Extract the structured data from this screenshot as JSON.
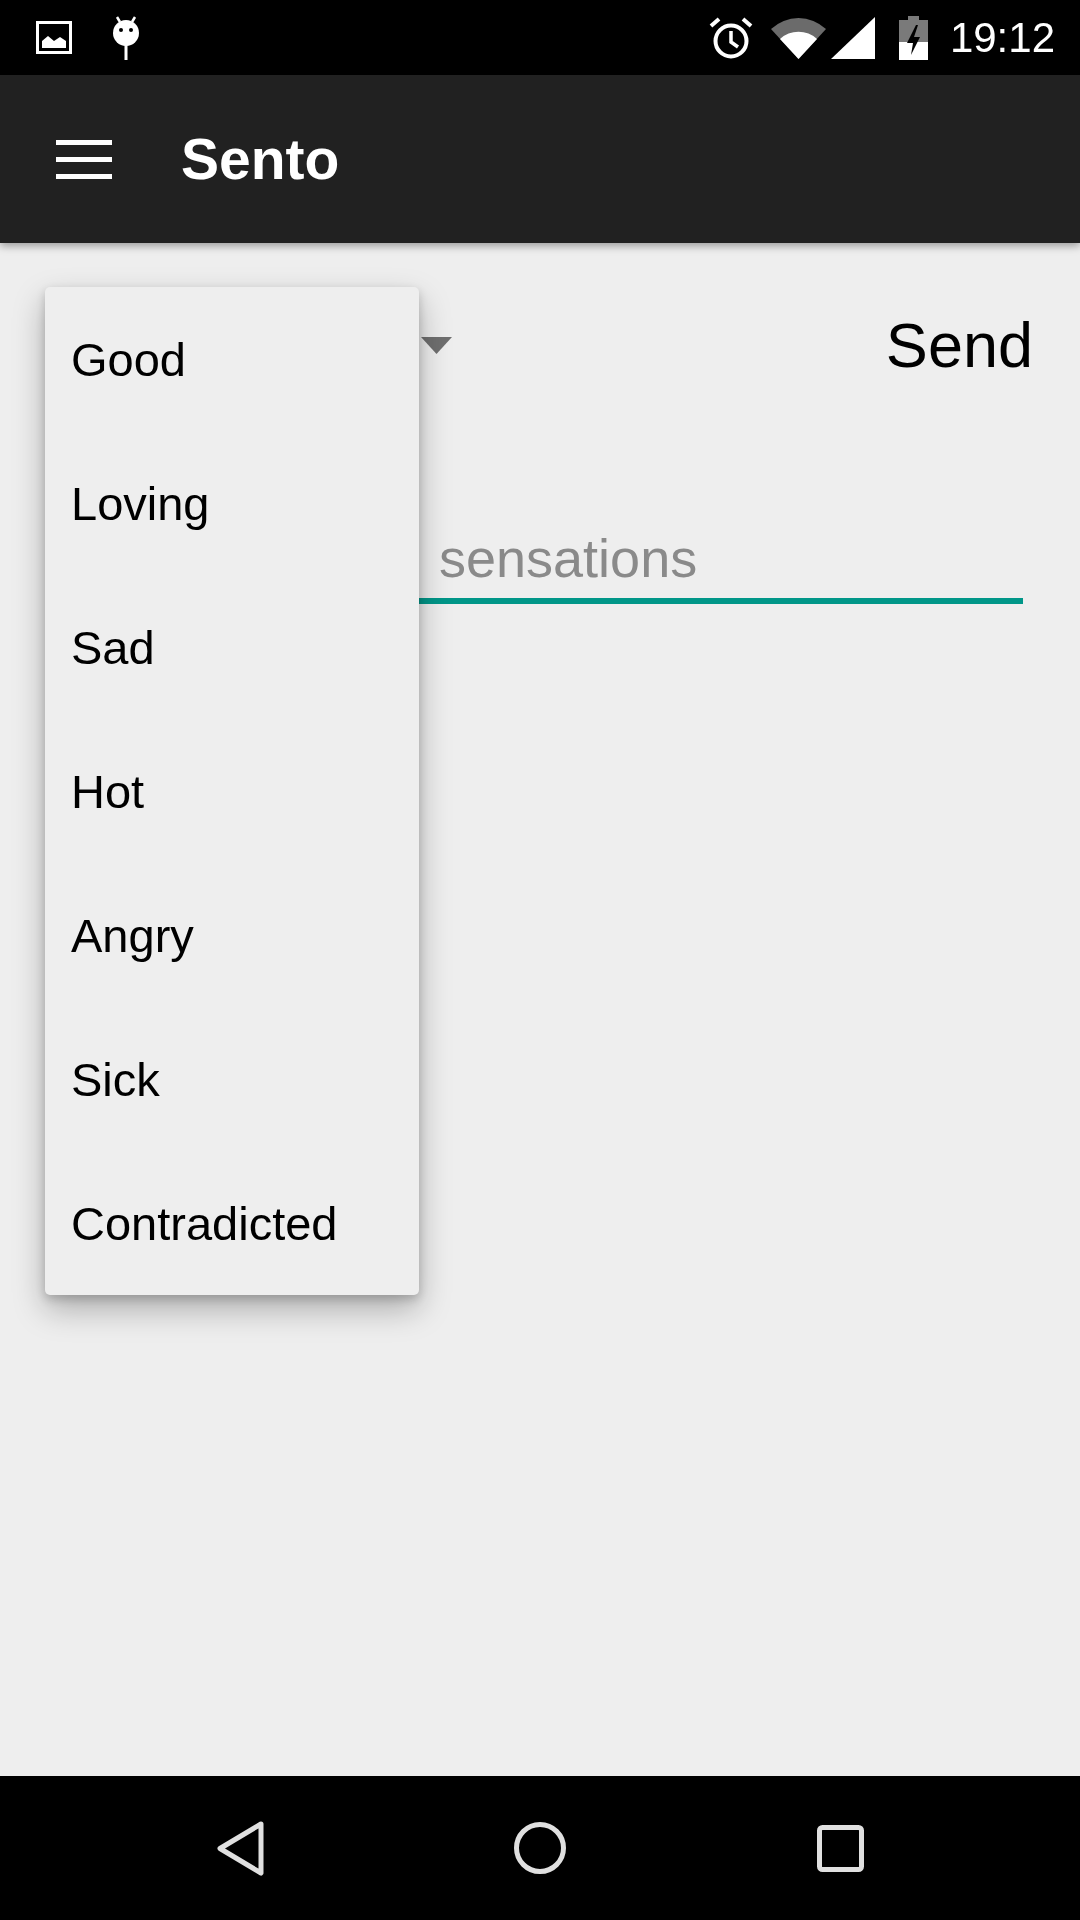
{
  "status_bar": {
    "time": "19:12"
  },
  "app_bar": {
    "title": "Sento"
  },
  "send_button": {
    "label": "Send"
  },
  "message_field": {
    "placeholder": "sensations"
  },
  "dropdown": {
    "items": [
      "Good",
      "Loving",
      "Sad",
      "Hot",
      "Angry",
      "Sick",
      "Contradicted"
    ]
  }
}
